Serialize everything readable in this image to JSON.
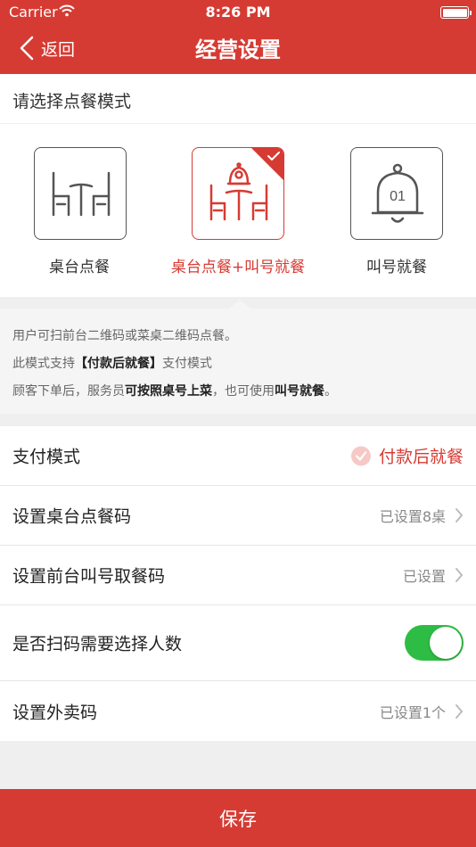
{
  "status_bar": {
    "carrier": "Carrier",
    "time": "8:26 PM"
  },
  "nav": {
    "back_label": "返回",
    "title": "经营设置"
  },
  "mode_section": {
    "title": "请选择点餐模式",
    "options": [
      {
        "label": "桌台点餐",
        "icon": "table-chairs-icon",
        "selected": false
      },
      {
        "label": "桌台点餐+叫号就餐",
        "icon": "table-bell-icon",
        "selected": true
      },
      {
        "label": "叫号就餐",
        "icon": "bell-number-icon",
        "selected": false,
        "icon_text": "01"
      }
    ]
  },
  "description": {
    "line1": "用户可扫前台二维码或菜桌二维码点餐。",
    "line2_a": "此模式支持",
    "line2_b": "【付款后就餐】",
    "line2_c": "支付模式",
    "line3_a": "顾客下单后，服务员",
    "line3_b": "可按照桌号上菜",
    "line3_c": "，也可使用",
    "line3_d": "叫号就餐",
    "line3_e": "。"
  },
  "settings": {
    "pay_mode_label": "支付模式",
    "pay_mode_value": "付款后就餐",
    "table_code_label": "设置桌台点餐码",
    "table_code_value": "已设置8桌",
    "front_code_label": "设置前台叫号取餐码",
    "front_code_value": "已设置",
    "headcount_label": "是否扫码需要选择人数",
    "headcount_enabled": true,
    "takeout_code_label": "设置外卖码",
    "takeout_code_value": "已设置1个"
  },
  "save_label": "保存",
  "colors": {
    "brand": "#d63b33",
    "toggle_on": "#2ebd44"
  }
}
